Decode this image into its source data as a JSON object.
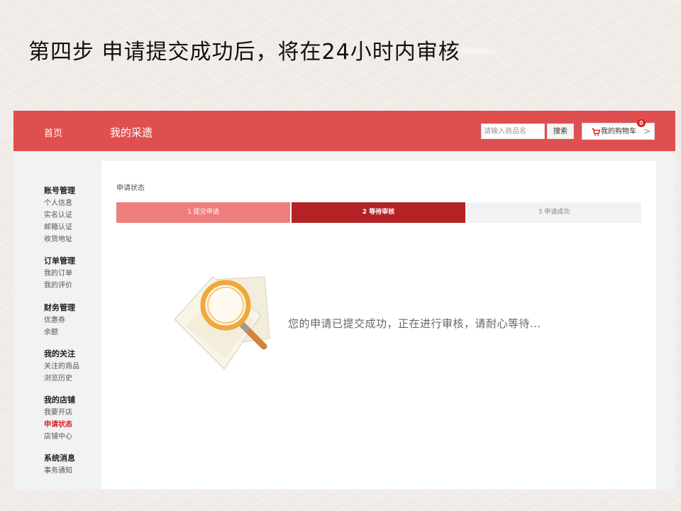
{
  "slide": {
    "title": "第四步 申请提交成功后，将在24小时内审核"
  },
  "header": {
    "home": "首页",
    "brand": "我的采遗",
    "search_placeholder": "请输入商品名",
    "search_button": "搜索",
    "cart_label": "我的购物车",
    "cart_count": "0",
    "cart_arrow": ">"
  },
  "sidebar": {
    "groups": [
      {
        "heading": "账号管理",
        "items": [
          "个人信息",
          "实名认证",
          "邮箱认证",
          "收货地址"
        ]
      },
      {
        "heading": "订单管理",
        "items": [
          "我的订单",
          "我的评价"
        ]
      },
      {
        "heading": "财务管理",
        "items": [
          "优惠券",
          "余额"
        ]
      },
      {
        "heading": "我的关注",
        "items": [
          "关注的商品",
          "浏览历史"
        ]
      },
      {
        "heading": "我的店铺",
        "items": [
          "我要开店",
          "申请状态",
          "店铺中心"
        ]
      },
      {
        "heading": "系统消息",
        "items": [
          "事务通知"
        ]
      }
    ],
    "active_item": "申请状态"
  },
  "main": {
    "status_title": "申请状态",
    "steps": [
      {
        "label": "1  提交申请",
        "state": "done"
      },
      {
        "label": "2  等待审核",
        "state": "current"
      },
      {
        "label": "3  申请成功",
        "state": "pending"
      }
    ],
    "message": "您的申请已提交成功，正在进行审核，请耐心等待..."
  },
  "colors": {
    "header_bg": "#e04f4f",
    "step_done": "#ef7e7e",
    "step_current": "#b32225",
    "active_link": "#d8232a"
  },
  "icons": {
    "cart": "cart-icon",
    "illustration": "magnifier-papers-icon"
  }
}
